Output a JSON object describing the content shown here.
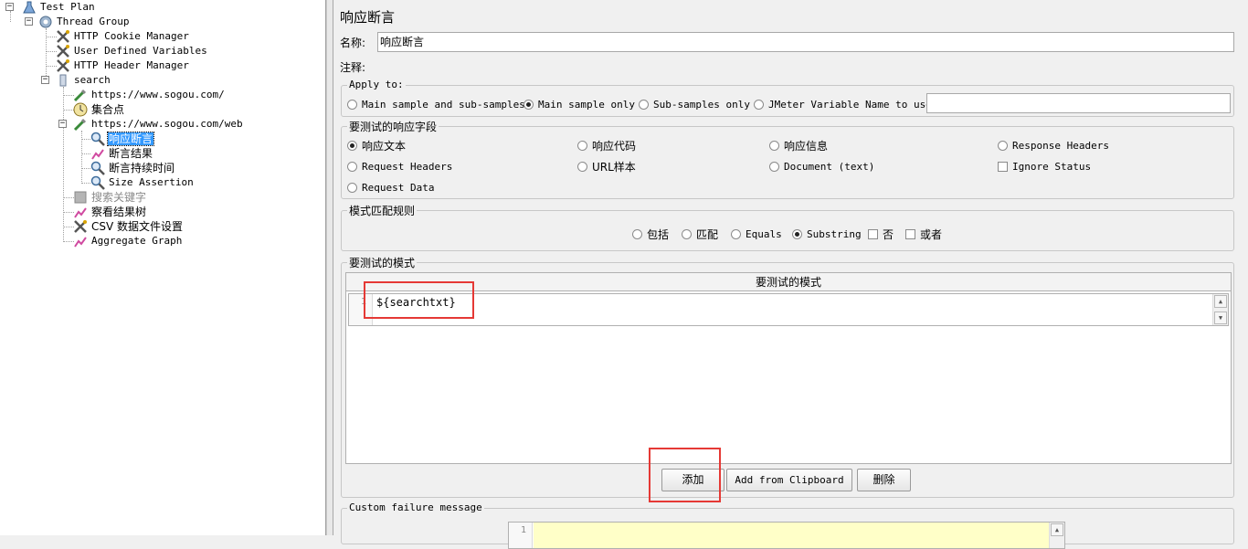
{
  "tree": {
    "test_plan": "Test Plan",
    "thread_group": "Thread Group",
    "cookie_manager": "HTTP Cookie Manager",
    "user_vars": "User Defined Variables",
    "header_manager": "HTTP Header Manager",
    "search": "search",
    "sampler1": "https://www.sogou.com/",
    "timer": "集合点",
    "sampler2": "https://www.sogou.com/web",
    "response_assertion": "响应断言",
    "assertion_results": "断言结果",
    "duration_assertion": "断言持续时间",
    "size_assertion": "Size Assertion",
    "search_keyword": "搜索关键字",
    "view_results_tree": "察看结果树",
    "csv_config": "CSV 数据文件设置",
    "aggregate_graph": "Aggregate Graph"
  },
  "panel": {
    "title": "响应断言",
    "name_label": "名称:",
    "name_value": "响应断言",
    "comments_label": "注释:",
    "comments_value": ""
  },
  "apply_to": {
    "legend": "Apply to:",
    "main_and_sub": "Main sample and sub-samples",
    "main_only": "Main sample only",
    "sub_only": "Sub-samples only",
    "jmeter_var": "JMeter Variable Name to use",
    "selected": "main_only",
    "var_value": ""
  },
  "fields": {
    "legend": "要测试的响应字段",
    "text_response": "响应文本",
    "response_code": "响应代码",
    "response_message": "响应信息",
    "response_headers": "Response Headers",
    "request_headers": "Request Headers",
    "url_sampled": "URL样本",
    "document": "Document (text)",
    "ignore_status": "Ignore Status",
    "request_data": "Request Data",
    "selected": "text_response"
  },
  "matching": {
    "legend": "模式匹配规则",
    "contains": "包括",
    "matches": "匹配",
    "equals": "Equals",
    "substring": "Substring",
    "not": "否",
    "or": "或者",
    "selected": "substring"
  },
  "patterns": {
    "legend": "要测试的模式",
    "column_header": "要测试的模式",
    "rows": [
      {
        "line": "1",
        "text": "${searchtxt}"
      }
    ]
  },
  "buttons": {
    "add": "添加",
    "add_clipboard": "Add from Clipboard",
    "delete": "删除"
  },
  "failure": {
    "legend": "Custom failure message",
    "line": "1"
  },
  "colors": {
    "selection": "#3399ff",
    "highlight_box": "#e53935",
    "failure_editor_bg": "#ffffc8"
  }
}
